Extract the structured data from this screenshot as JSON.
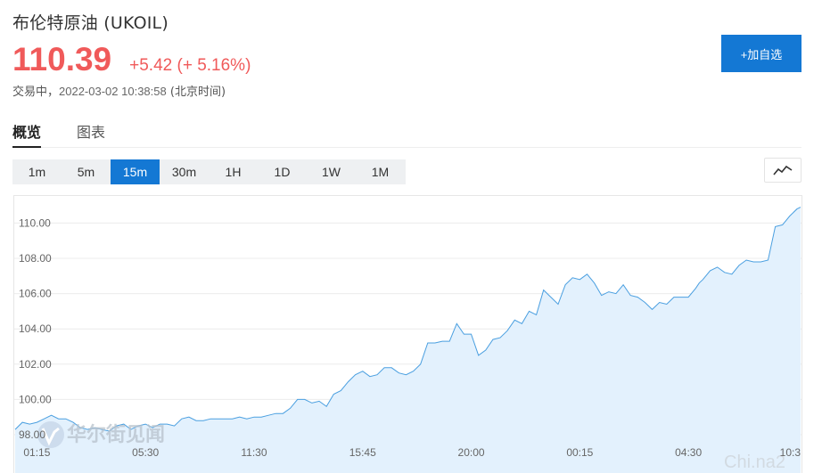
{
  "header": {
    "title": "布伦特原油  (UKOIL)",
    "price": "110.39",
    "change": "+5.42 (+ 5.16%)",
    "status": "交易中，",
    "timestamp": "2022-03-02 10:38:58",
    "timezone": " (北京时间)"
  },
  "actions": {
    "add_watch": "+加自选"
  },
  "tabs": [
    {
      "label": "概览",
      "active": true
    },
    {
      "label": "图表",
      "active": false
    }
  ],
  "periods": [
    {
      "label": "1m",
      "active": false
    },
    {
      "label": "5m",
      "active": false
    },
    {
      "label": "15m",
      "active": true
    },
    {
      "label": "30m",
      "active": false
    },
    {
      "label": "1H",
      "active": false
    },
    {
      "label": "1D",
      "active": false
    },
    {
      "label": "1W",
      "active": false
    },
    {
      "label": "1M",
      "active": false
    }
  ],
  "chart_type_icon": "line-chart-icon",
  "colors": {
    "accent": "#1478d4",
    "up": "#f05a5a",
    "line": "#4a9fe0",
    "area": "#e3f1fd",
    "grid": "#ececec"
  },
  "watermark": {
    "text": "华尔街见闻",
    "corner": "Chi.na2"
  },
  "chart_data": {
    "type": "area",
    "title": "",
    "xlabel": "",
    "ylabel": "",
    "ylim": [
      98.5,
      111.0
    ],
    "yticks": [
      {
        "v": 98.0,
        "label": "98.00"
      },
      {
        "v": 100.0,
        "label": "100.00"
      },
      {
        "v": 102.0,
        "label": "102.00"
      },
      {
        "v": 104.0,
        "label": "104.00"
      },
      {
        "v": 106.0,
        "label": "106.00"
      },
      {
        "v": 108.0,
        "label": "108.00"
      },
      {
        "v": 110.0,
        "label": "110.00"
      }
    ],
    "xticks": [
      {
        "i": 3,
        "label": "01:15"
      },
      {
        "i": 18,
        "label": "05:30"
      },
      {
        "i": 33,
        "label": "11:30"
      },
      {
        "i": 48,
        "label": "15:45"
      },
      {
        "i": 63,
        "label": "20:00"
      },
      {
        "i": 78,
        "label": "00:15"
      },
      {
        "i": 93,
        "label": "04:30"
      },
      {
        "i": 108,
        "label": "10:3"
      }
    ],
    "x": [
      0,
      1,
      2,
      3,
      4,
      5,
      6,
      7,
      8,
      9,
      10,
      11,
      12,
      13,
      14,
      15,
      16,
      17,
      18,
      19,
      20,
      21,
      22,
      23,
      24,
      25,
      26,
      27,
      28,
      29,
      30,
      31,
      32,
      33,
      34,
      35,
      36,
      37,
      38,
      39,
      40,
      41,
      42,
      43,
      44,
      45,
      46,
      47,
      48,
      49,
      50,
      51,
      52,
      53,
      54,
      55,
      56,
      57,
      58,
      59,
      60,
      61,
      62,
      63,
      64,
      65,
      66,
      67,
      68,
      69,
      70,
      71,
      72,
      73,
      74,
      75,
      76,
      77,
      78,
      79,
      80,
      81,
      82,
      83,
      84,
      85,
      86,
      87,
      88,
      89,
      90,
      91,
      92,
      93,
      94,
      94.5,
      95,
      96,
      97,
      98,
      99,
      100,
      101,
      102,
      103,
      104,
      105,
      106,
      107,
      108,
      108.5
    ],
    "series": [
      {
        "name": "",
        "values": [
          98.3,
          98.7,
          98.6,
          98.7,
          98.9,
          99.1,
          98.9,
          98.9,
          98.7,
          98.4,
          98.3,
          98.4,
          98.3,
          98.2,
          98.5,
          98.6,
          98.3,
          98.5,
          98.6,
          98.4,
          98.6,
          98.6,
          98.5,
          98.9,
          99.0,
          98.8,
          98.8,
          98.9,
          98.9,
          98.9,
          98.9,
          99.0,
          98.9,
          99.0,
          99.0,
          99.1,
          99.2,
          99.2,
          99.5,
          100.0,
          100.0,
          99.8,
          99.9,
          99.6,
          100.3,
          100.5,
          101.0,
          101.4,
          101.6,
          101.3,
          101.4,
          101.8,
          101.8,
          101.5,
          101.4,
          101.6,
          102.0,
          103.2,
          103.2,
          103.3,
          103.3,
          104.3,
          103.7,
          103.7,
          102.5,
          102.8,
          103.4,
          103.5,
          103.9,
          104.5,
          104.3,
          105.0,
          104.8,
          106.2,
          105.8,
          105.4,
          106.5,
          106.9,
          106.8,
          107.1,
          106.6,
          105.9,
          106.1,
          106.0,
          106.5,
          105.9,
          105.8,
          105.5,
          105.1,
          105.5,
          105.4,
          105.8,
          105.8,
          105.8,
          106.3,
          106.6,
          106.8,
          107.3,
          107.5,
          107.2,
          107.1,
          107.6,
          107.9,
          107.8,
          107.8,
          107.9,
          109.8,
          109.9,
          110.4,
          110.8,
          110.9
        ]
      }
    ],
    "grid": true,
    "legend": "none"
  }
}
